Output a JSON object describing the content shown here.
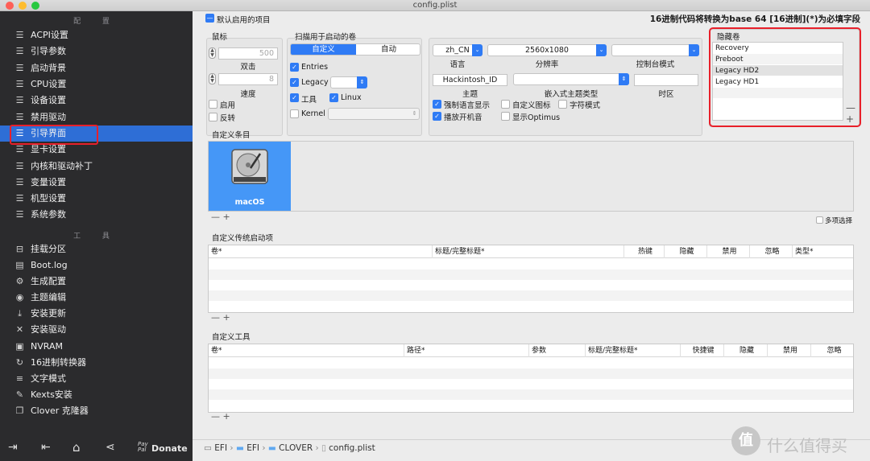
{
  "window": {
    "title": "config.plist"
  },
  "sidebar": {
    "config_header": "配 置",
    "items": [
      {
        "label": "ACPI设置"
      },
      {
        "label": "引导参数"
      },
      {
        "label": "启动背景"
      },
      {
        "label": "CPU设置"
      },
      {
        "label": "设备设置"
      },
      {
        "label": "禁用驱动"
      },
      {
        "label": "引导界面"
      },
      {
        "label": "显卡设置"
      },
      {
        "label": "内核和驱动补丁"
      },
      {
        "label": "变量设置"
      },
      {
        "label": "机型设置"
      },
      {
        "label": "系统参数"
      }
    ],
    "active_index": 6,
    "tools_header": "工 具",
    "tools": [
      {
        "label": "挂载分区",
        "icon": "disk-icon"
      },
      {
        "label": "Boot.log",
        "icon": "log-icon"
      },
      {
        "label": "生成配置",
        "icon": "gears-icon"
      },
      {
        "label": "主题编辑",
        "icon": "palette-icon"
      },
      {
        "label": "安装更新",
        "icon": "download-icon"
      },
      {
        "label": "安装驱动",
        "icon": "wrench-icon"
      },
      {
        "label": "NVRAM",
        "icon": "chip-icon"
      },
      {
        "label": "16进制转换器",
        "icon": "refresh-icon"
      },
      {
        "label": "文字模式",
        "icon": "text-icon"
      },
      {
        "label": "Kexts安装",
        "icon": "brush-icon"
      },
      {
        "label": "Clover 克隆器",
        "icon": "copy-icon"
      }
    ],
    "bottom": {
      "paypal_top": "Pay",
      "paypal_bottom": "Pal",
      "donate": "Donate"
    }
  },
  "header": {
    "default_enabled_label": "默认启用的项目",
    "hex_note": "16进制代码将转换为base 64 [16进制](*)为必填字段"
  },
  "mouse": {
    "title": "鼠标",
    "double_click_value": "500",
    "double_click_label": "双击",
    "speed_value": "8",
    "speed_label": "速度",
    "enable_label": "启用",
    "mirror_label": "反转"
  },
  "scan": {
    "title": "扫描用于启动的卷",
    "seg_custom": "自定义",
    "seg_auto": "自动",
    "entries_label": "Entries",
    "legacy_label": "Legacy",
    "tools_label": "工具",
    "linux_label": "Linux",
    "kernel_label": "Kernel"
  },
  "gui": {
    "language_value": "zh_CN",
    "language_label": "语言",
    "resolution_value": "2560x1080",
    "resolution_label": "分辨率",
    "console_mode_label": "控制台模式",
    "theme_value": "Hackintosh_ID",
    "theme_label": "主题",
    "embedded_theme_label": "嵌入式主题类型",
    "timezone_label": "时区",
    "force_lang_label": "强制语言显示",
    "custom_icons_label": "自定义图标",
    "text_mode_label": "字符模式",
    "play_chime_label": "播放开机音",
    "show_optimus_label": "显示Optimus"
  },
  "hidden_volumes": {
    "title": "隐藏卷",
    "items": [
      "Recovery",
      "Preboot",
      "Legacy HD2",
      "Legacy HD1"
    ]
  },
  "custom_entries": {
    "title": "自定义条目",
    "entry_label": "macOS",
    "multi_select_label": "多项选择"
  },
  "legacy_entries": {
    "title": "自定义传统启动项",
    "columns": [
      "卷*",
      "标题/完整标题*",
      "热键",
      "隐藏",
      "禁用",
      "忽略",
      "类型*"
    ]
  },
  "custom_tools": {
    "title": "自定义工具",
    "columns": [
      "卷*",
      "路径*",
      "参数",
      "标题/完整标题*",
      "快捷键",
      "隐藏",
      "禁用",
      "忽略"
    ]
  },
  "path_bar": {
    "crumbs": [
      "EFI",
      "EFI",
      "CLOVER",
      "config.plist"
    ]
  },
  "watermark": {
    "text": "什么值得买",
    "badge": "值"
  },
  "colors": {
    "accent": "#2f7bf5",
    "sidebar_bg": "#2b2b2d",
    "highlight_red": "#e8202a"
  }
}
